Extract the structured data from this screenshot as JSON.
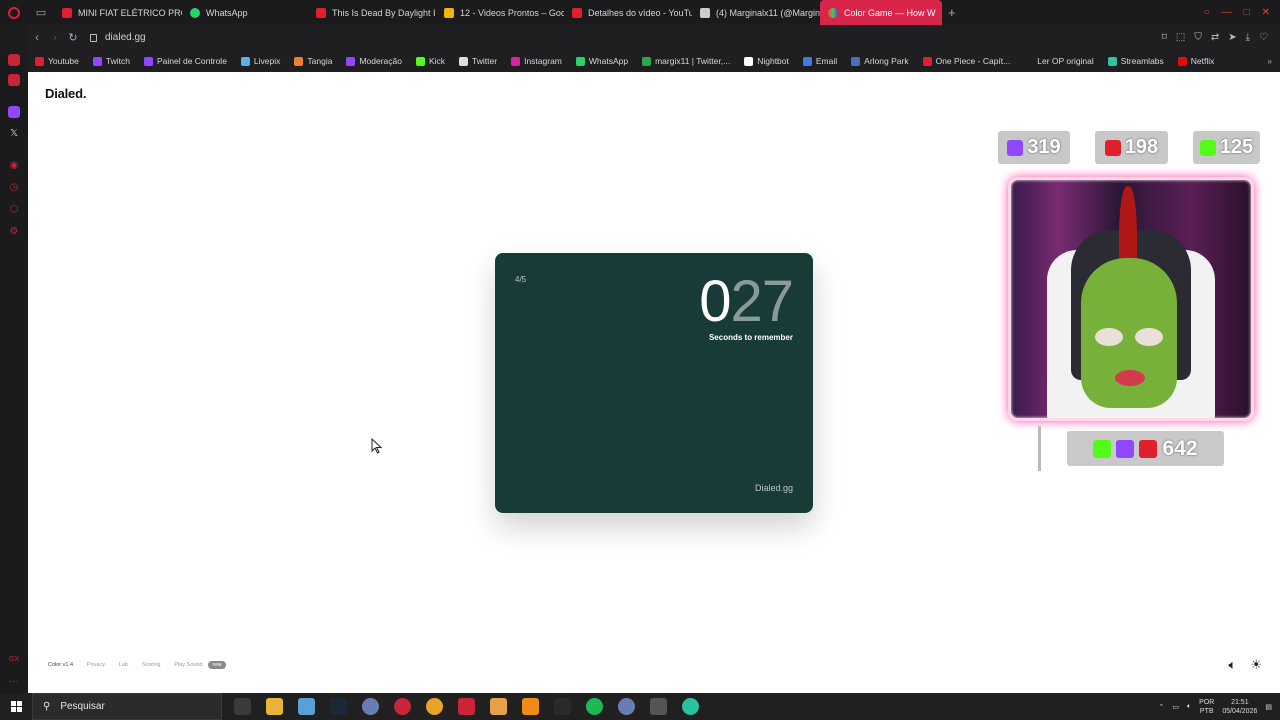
{
  "browser": {
    "tabs": [
      {
        "label": "MINI FIAT ELÉTRICO PRO!",
        "color": "#e0202e"
      },
      {
        "label": "WhatsApp",
        "color": "#25d366"
      },
      {
        "label": "This Is Dead By Daylight I",
        "color": "#e0202e"
      },
      {
        "label": "12 - Videos Prontos – Goo",
        "color": "#f2b30b"
      },
      {
        "label": "Detalhes do vídeo - YouTu",
        "color": "#e0202e"
      },
      {
        "label": "(4) Marginalx11 (@Margin",
        "color": "#cccccc"
      },
      {
        "label": "Color Game — How W",
        "color": "#ffffff"
      }
    ],
    "active_tab_index": 6,
    "url": "dialed.gg",
    "bookmarks": [
      {
        "label": "Youtube",
        "color": "#e0202e"
      },
      {
        "label": "Twitch",
        "color": "#9146ff"
      },
      {
        "label": "Painel de Controle",
        "color": "#9146ff"
      },
      {
        "label": "Livepix",
        "color": "#57b4e6"
      },
      {
        "label": "Tangia",
        "color": "#f07f2b"
      },
      {
        "label": "Moderação",
        "color": "#9146ff"
      },
      {
        "label": "Kick",
        "color": "#53fc18"
      },
      {
        "label": "Twitter",
        "color": "#dddddd"
      },
      {
        "label": "Instagram",
        "color": "#d6249f"
      },
      {
        "label": "WhatsApp",
        "color": "#25d366"
      },
      {
        "label": "margix11 | Twitter,...",
        "color": "#2ea44f"
      },
      {
        "label": "Nightbot",
        "color": "#ffffff"
      },
      {
        "label": "Email",
        "color": "#3d7de0"
      },
      {
        "label": "Arlong Park",
        "color": "#4b6dbd"
      },
      {
        "label": "One Piece - Capít...",
        "color": "#e0202e"
      },
      {
        "label": "Ler OP original",
        "color": "#1f1f21"
      },
      {
        "label": "Streamlabs",
        "color": "#31c3a2"
      },
      {
        "label": "Netflix",
        "color": "#e50914"
      }
    ]
  },
  "page": {
    "brand": "Dialed.",
    "card": {
      "progress": "4/5",
      "digit_lead": "0",
      "digit_rest": "27",
      "caption": "Seconds to remember",
      "site": "Dialed.gg",
      "bg_color": "#193b37"
    },
    "footer": {
      "version": "Color v1.4",
      "links": [
        "Privacy",
        "Lab",
        "Scoring",
        "Play Sound"
      ],
      "badge": "new"
    }
  },
  "overlay": {
    "twitch_count": "319",
    "youtube_count": "198",
    "kick_count": "125",
    "total_count": "642"
  },
  "taskbar": {
    "search_placeholder": "Pesquisar",
    "lang_top": "POR",
    "lang_bottom": "PTB",
    "time": "21:51",
    "date": "05/04/2026"
  }
}
